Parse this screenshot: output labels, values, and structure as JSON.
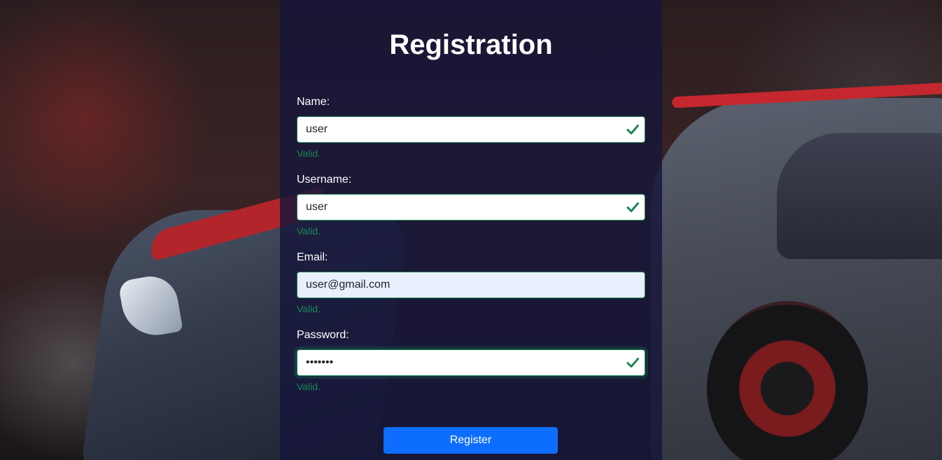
{
  "page": {
    "title": "Registration"
  },
  "form": {
    "fields": [
      {
        "label": "Name:",
        "value": "user",
        "feedback": "Valid."
      },
      {
        "label": "Username:",
        "value": "user",
        "feedback": "Valid."
      },
      {
        "label": "Email:",
        "value": "user@gmail.com",
        "feedback": "Valid."
      },
      {
        "label": "Password:",
        "value": "•••••••",
        "feedback": "Valid."
      }
    ],
    "submit_label": "Register"
  },
  "colors": {
    "valid": "#198754",
    "primary_button": "#0d6efd",
    "panel": "#16163a"
  },
  "icons": {
    "valid": "check-icon"
  }
}
